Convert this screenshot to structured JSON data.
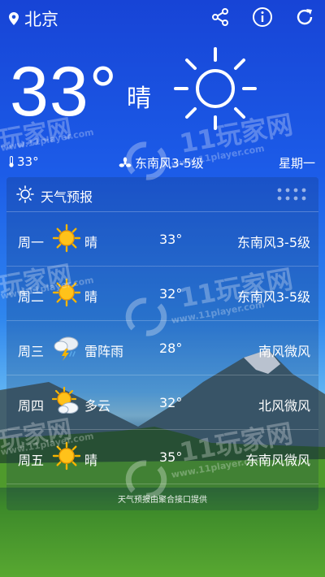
{
  "header": {
    "city": "北京",
    "icons": [
      "location-pin-icon",
      "share-icon",
      "info-icon",
      "refresh-icon"
    ]
  },
  "current": {
    "temperature": "33°",
    "condition": "晴",
    "sub_temp": "33°",
    "wind": "东南风3-5级",
    "weekday": "星期一"
  },
  "forecast": {
    "title": "天气预报",
    "rows": [
      {
        "day": "周一",
        "icon": "sun-icon",
        "condition": "晴",
        "temp": "33°",
        "wind": "东南风3-5级"
      },
      {
        "day": "周二",
        "icon": "sun-icon",
        "condition": "晴",
        "temp": "32°",
        "wind": "东南风3-5级"
      },
      {
        "day": "周三",
        "icon": "thunderstorm-icon",
        "condition": "雷阵雨",
        "temp": "28°",
        "wind": "南风微风"
      },
      {
        "day": "周四",
        "icon": "partly-cloudy-icon",
        "condition": "多云",
        "temp": "32°",
        "wind": "北风微风"
      },
      {
        "day": "周五",
        "icon": "sun-icon",
        "condition": "晴",
        "temp": "35°",
        "wind": "东南风微风"
      }
    ],
    "footer": "天气预报由聚合接口提供"
  },
  "watermark": {
    "brand": "11玩家网",
    "brand_short": "玩家网",
    "url": "www.11player.com"
  },
  "colors": {
    "sky_top": "#1744d6",
    "sun": "#f5b400"
  }
}
